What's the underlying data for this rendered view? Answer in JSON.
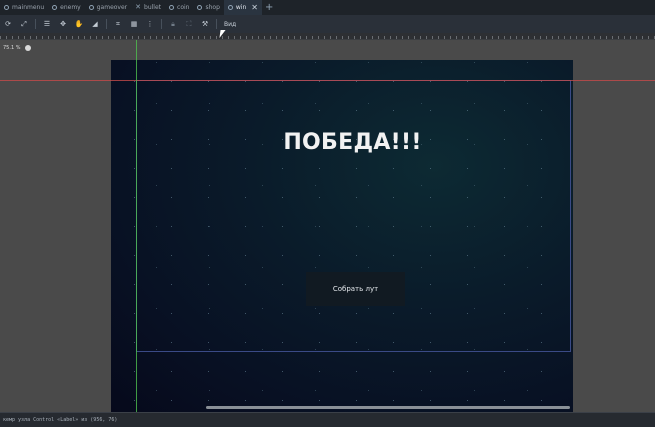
{
  "tabs": [
    {
      "label": "mainmenu",
      "icon": "circle-icon"
    },
    {
      "label": "enemy",
      "icon": "circle-icon"
    },
    {
      "label": "gameover",
      "icon": "circle-icon"
    },
    {
      "label": "bullet",
      "icon": "cross-icon"
    },
    {
      "label": "coin",
      "icon": "circle-icon"
    },
    {
      "label": "shop",
      "icon": "circle-icon"
    },
    {
      "label": "win",
      "icon": "circle-icon",
      "active": true
    }
  ],
  "toolbar": {
    "view_label": "Вид"
  },
  "viewport": {
    "zoom_label": "75.1 %"
  },
  "scene": {
    "title": "ПОБЕДА!!!",
    "button_label": "Собрать лут"
  },
  "status_text": "кемр узла Control «Label» из (956, 76)",
  "colors": {
    "accent": "#4b6cae",
    "background": "#4a4a4a"
  }
}
